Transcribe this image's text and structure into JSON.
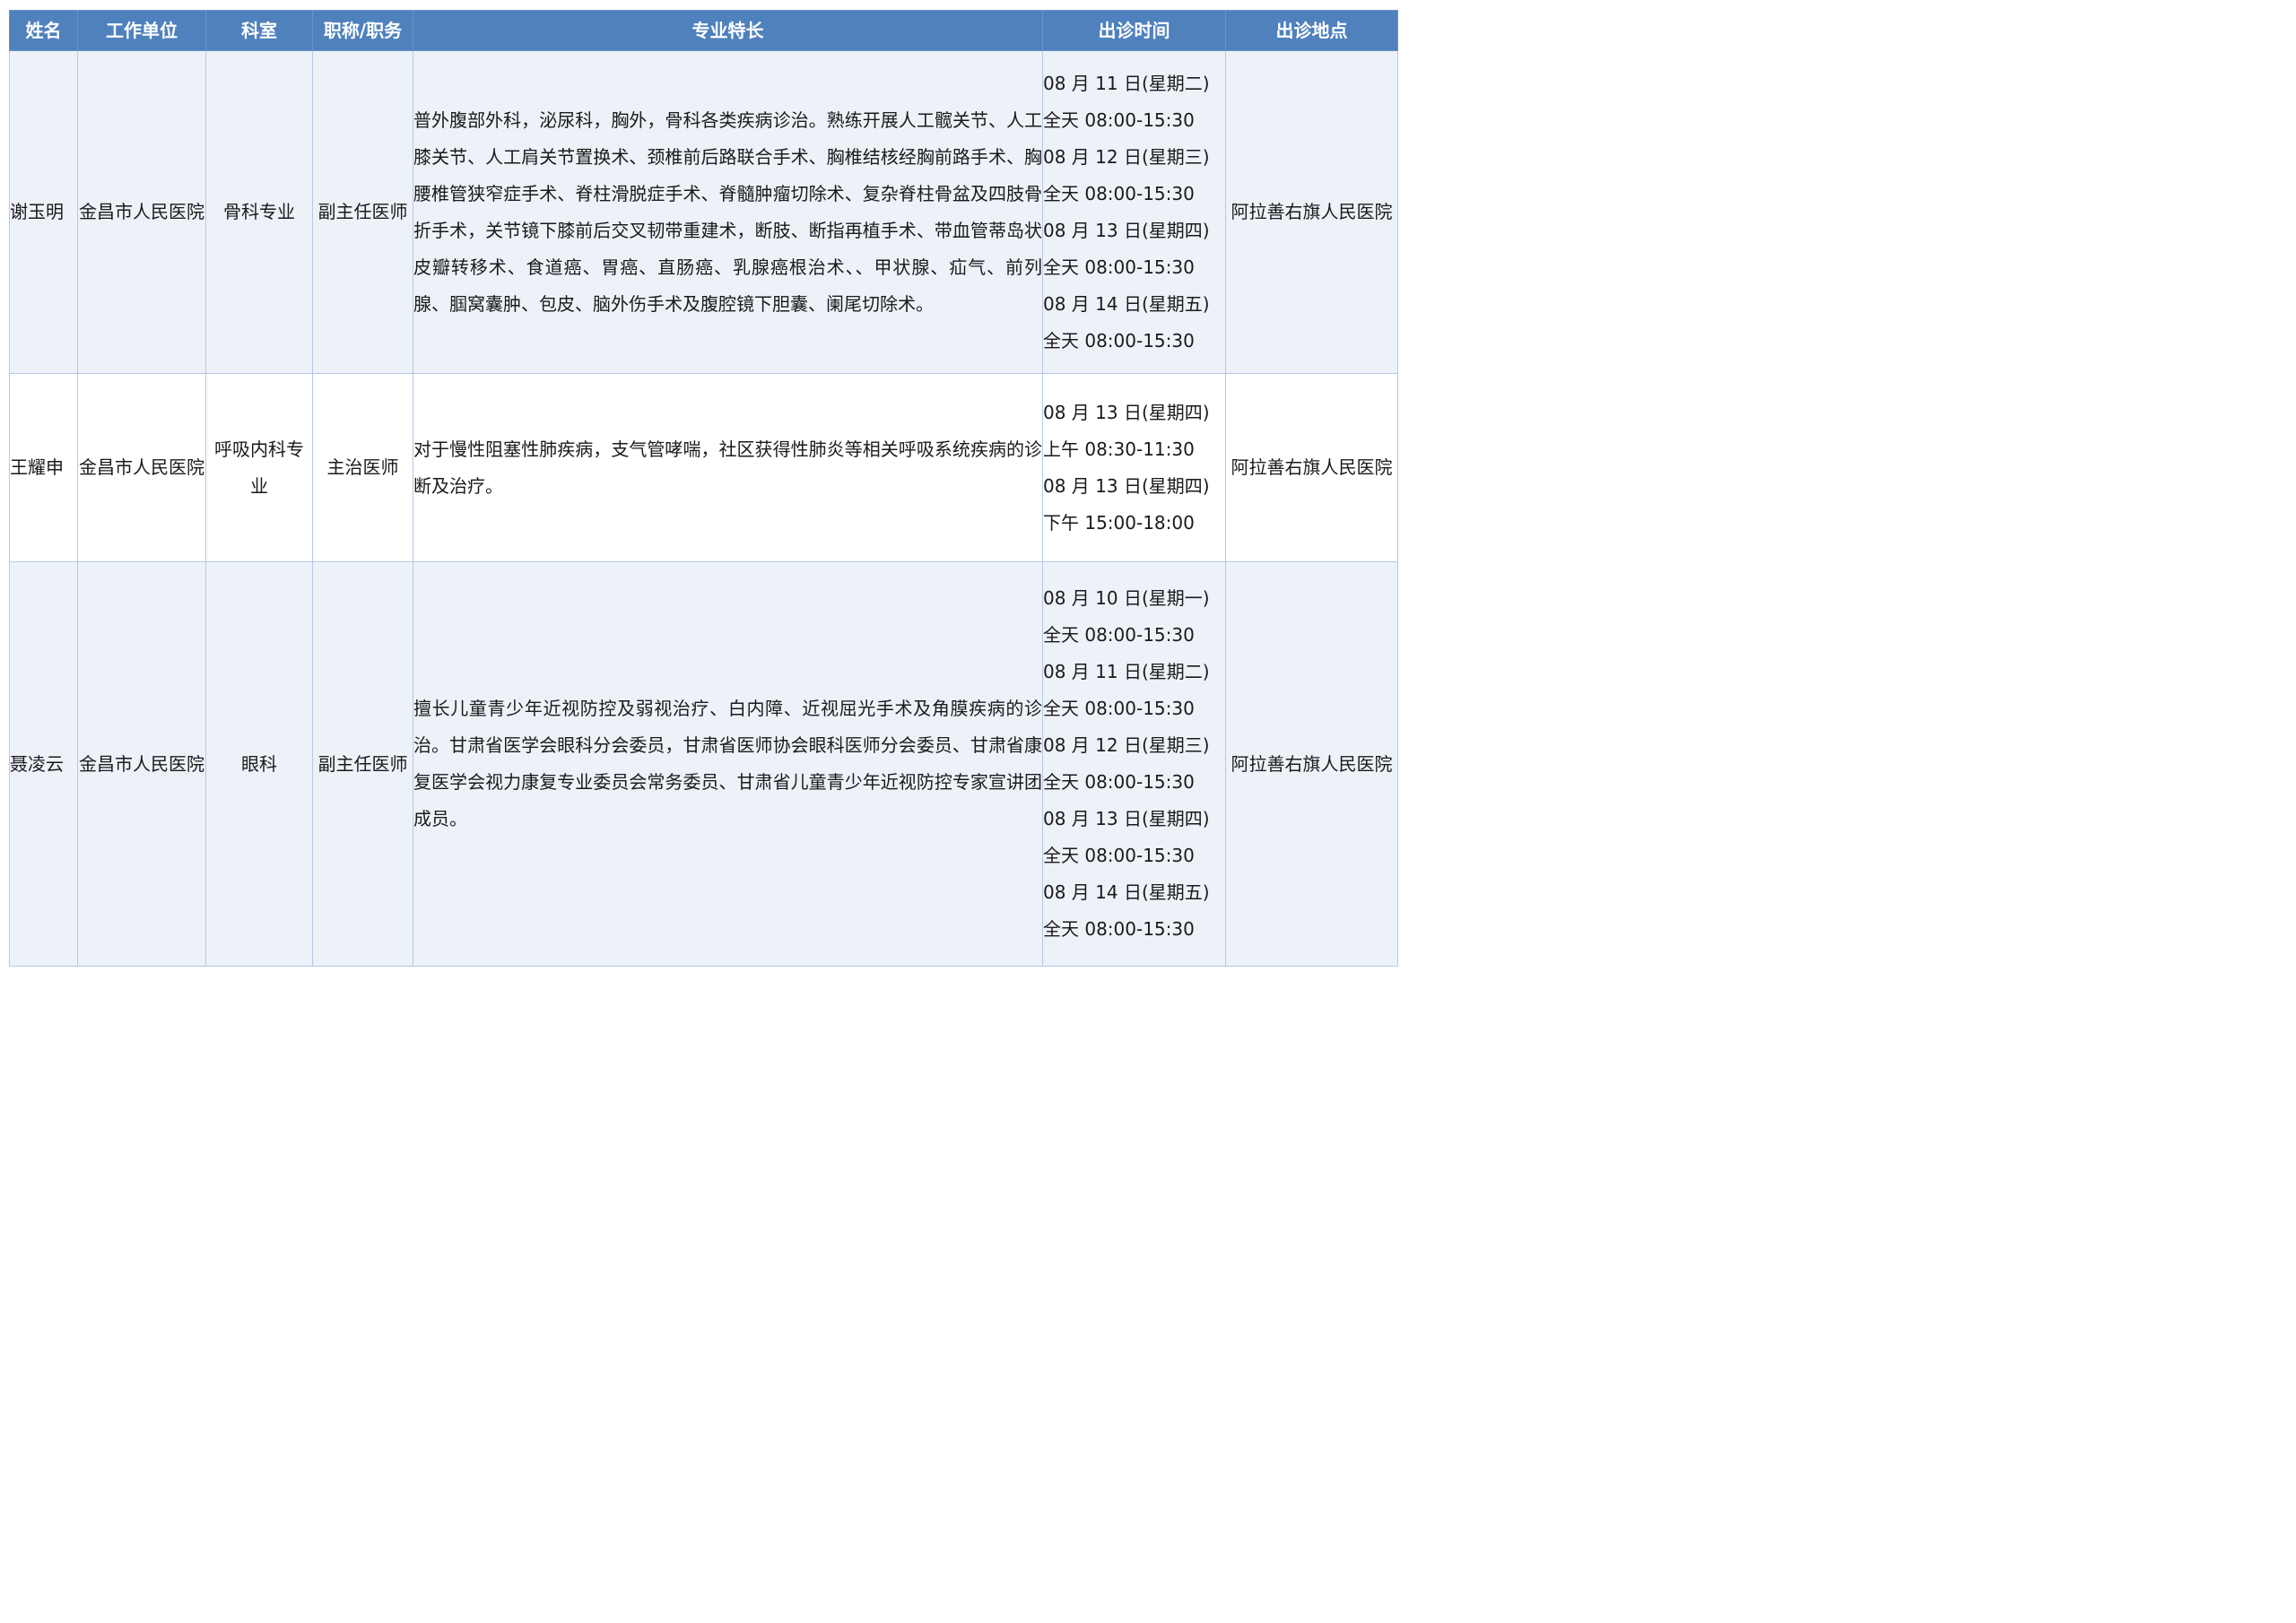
{
  "headers": {
    "name": "姓名",
    "unit": "工作单位",
    "dept": "科室",
    "title": "职称/职务",
    "specialty": "专业特长",
    "time": "出诊时间",
    "place": "出诊地点"
  },
  "rows": [
    {
      "name": "谢玉明",
      "unit": "金昌市人民医院",
      "dept": "骨科专业",
      "title": "副主任医师",
      "specialty": "普外腹部外科，泌尿科，胸外，骨科各类疾病诊治。熟练开展人工髋关节、人工膝关节、人工肩关节置换术、颈椎前后路联合手术、胸椎结核经胸前路手术、胸腰椎管狭窄症手术、脊柱滑脱症手术、脊髓肿瘤切除术、复杂脊柱骨盆及四肢骨折手术，关节镜下膝前后交叉韧带重建术，断肢、断指再植手术、带血管蒂岛状皮瓣转移术、食道癌、胃癌、直肠癌、乳腺癌根治术、、甲状腺、疝气、前列腺、腘窝囊肿、包皮、脑外伤手术及腹腔镜下胆囊、阑尾切除术。",
      "times": [
        "08 月 11 日(星期二)",
        "全天 08:00-15:30",
        "08 月 12 日(星期三)",
        "全天 08:00-15:30",
        "08 月 13 日(星期四)",
        "全天 08:00-15:30",
        "08 月 14 日(星期五)",
        "全天 08:00-15:30"
      ],
      "place": "阿拉善右旗人民医院"
    },
    {
      "name": "王耀申",
      "unit": "金昌市人民医院",
      "dept": "呼吸内科专业",
      "title": "主治医师",
      "specialty": "对于慢性阻塞性肺疾病，支气管哮喘，社区获得性肺炎等相关呼吸系统疾病的诊断及治疗。",
      "times": [
        "08 月 13 日(星期四)",
        "上午 08:30-11:30",
        "08 月 13 日(星期四)",
        "下午 15:00-18:00"
      ],
      "place": "阿拉善右旗人民医院"
    },
    {
      "name": "聂凌云",
      "unit": "金昌市人民医院",
      "dept": "眼科",
      "title": "副主任医师",
      "specialty": "擅长儿童青少年近视防控及弱视治疗、白内障、近视屈光手术及角膜疾病的诊治。甘肃省医学会眼科分会委员，甘肃省医师协会眼科医师分会委员、甘肃省康复医学会视力康复专业委员会常务委员、甘肃省儿童青少年近视防控专家宣讲团成员。",
      "times": [
        "08 月 10 日(星期一)",
        "全天 08:00-15:30",
        "08 月 11 日(星期二)",
        "全天 08:00-15:30",
        "08 月 12 日(星期三)",
        "全天 08:00-15:30",
        "08 月 13 日(星期四)",
        "全天 08:00-15:30",
        "08 月 14 日(星期五)",
        "全天 08:00-15:30"
      ],
      "place": "阿拉善右旗人民医院"
    }
  ],
  "colors": {
    "header_bg": "#4f81bd",
    "header_text": "#ffffff",
    "alt_row_bg": "#edf2f9",
    "border": "#b8c9e3"
  }
}
